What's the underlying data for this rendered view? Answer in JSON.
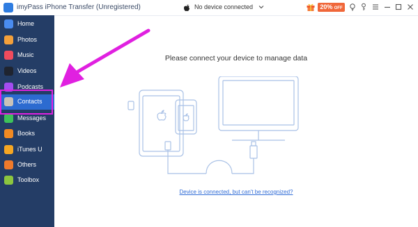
{
  "window": {
    "title": "imyPass iPhone Transfer (Unregistered)"
  },
  "device_selector": {
    "label": "No device connected"
  },
  "promo": {
    "percent": "20%",
    "off": "OFF"
  },
  "sidebar": {
    "items": [
      {
        "label": "Home",
        "icon": "home-icon",
        "color": "#4a8cf0"
      },
      {
        "label": "Photos",
        "icon": "photos-icon",
        "color": "#f3a03b"
      },
      {
        "label": "Music",
        "icon": "music-icon",
        "color": "#ef4b5d"
      },
      {
        "label": "Videos",
        "icon": "videos-icon",
        "color": "#1f2430"
      },
      {
        "label": "Podcasts",
        "icon": "podcasts-icon",
        "color": "#a24df0"
      },
      {
        "label": "Contacts",
        "icon": "contacts-icon",
        "color": "#c9c2b8"
      },
      {
        "label": "Messages",
        "icon": "messages-icon",
        "color": "#3ec25a"
      },
      {
        "label": "Books",
        "icon": "books-icon",
        "color": "#f28a23"
      },
      {
        "label": "iTunes U",
        "icon": "itunes-u-icon",
        "color": "#f5a623"
      },
      {
        "label": "Others",
        "icon": "others-icon",
        "color": "#f07a2b"
      },
      {
        "label": "Toolbox",
        "icon": "toolbox-icon",
        "color": "#8cc63f"
      }
    ],
    "active": "Contacts"
  },
  "main": {
    "message": "Please connect your device to manage data",
    "link": "Device is connected, but can't be recognized?"
  },
  "colors": {
    "sidebar_bg": "#243d66",
    "active_item": "#2c6bd0",
    "annotation": "#e020e0",
    "illustration_stroke": "#a9c1e6"
  }
}
